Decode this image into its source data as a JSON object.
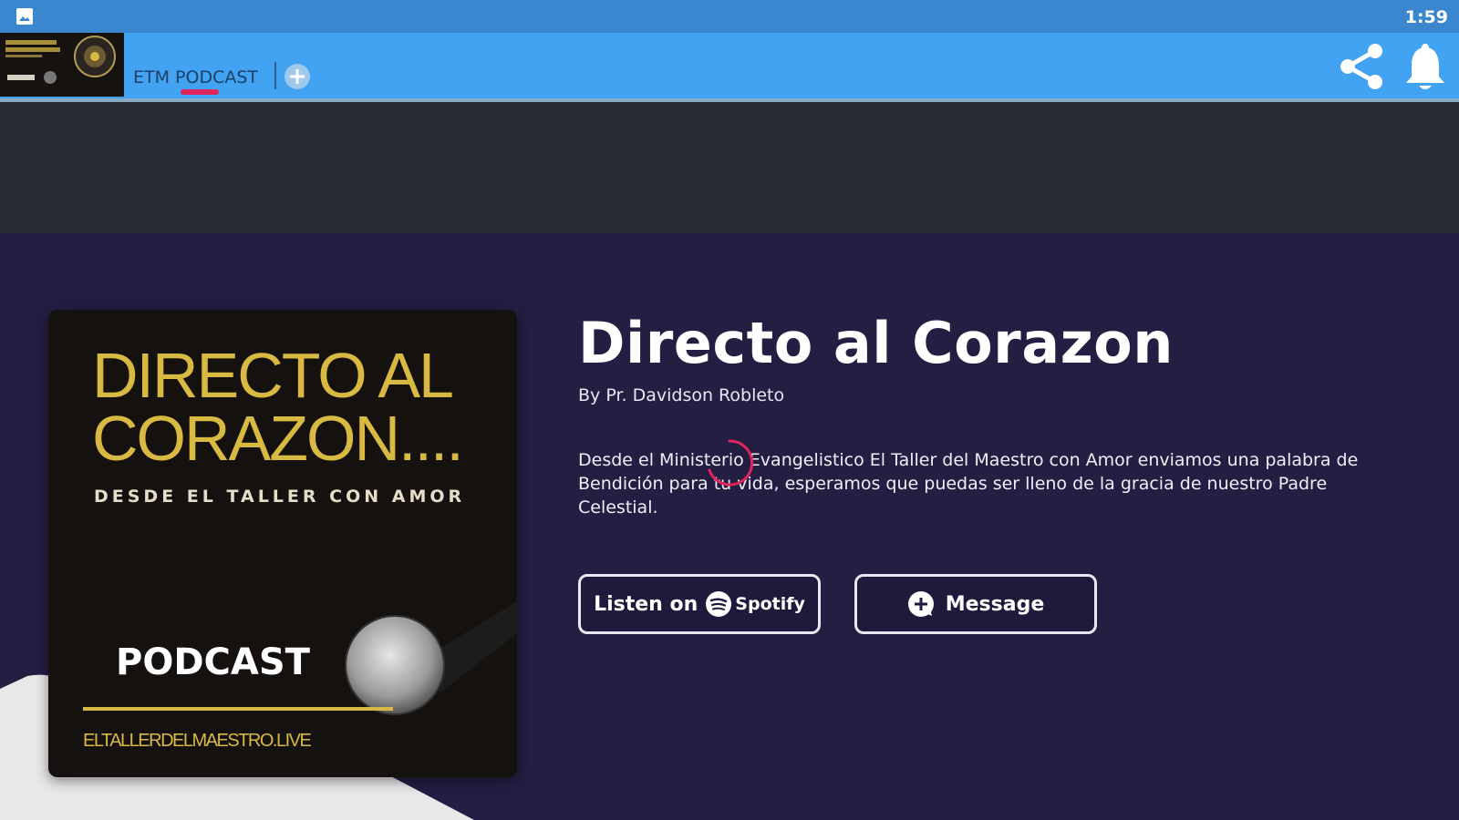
{
  "status_bar": {
    "time": "1:59",
    "icon": "image-icon"
  },
  "app_bar": {
    "tab_label": "ETM PODCAST",
    "add_icon": "add-circle-icon",
    "share_icon": "share-icon",
    "bell_icon": "bell-icon"
  },
  "podcast": {
    "title": "Directo al Corazon",
    "author": "By Pr. Davidson Robleto",
    "description": "Desde el Ministerio Evangelistico El Taller del Maestro con Amor enviamos una palabra de Bendición para tu vida, esperamos que puedas ser lleno de la gracia de nuestro Padre Celestial."
  },
  "cover": {
    "line1": "DIRECTO AL",
    "line2": "CORAZON....",
    "subtitle": "DESDE EL TALLER CON AMOR",
    "podcast_label": "PODCAST",
    "url": "ELTALLERDELMAESTRO.LIVE"
  },
  "actions": {
    "listen_label": "Listen on",
    "spotify_label": "Spotify",
    "message_label": "Message"
  },
  "colors": {
    "status_bar": "#3a87cf",
    "app_bar": "#42a3f2",
    "banner": "#282b35",
    "hero_bg": "#231e42",
    "accent_gold": "#d8b941",
    "tab_indicator": "#e0245e"
  }
}
